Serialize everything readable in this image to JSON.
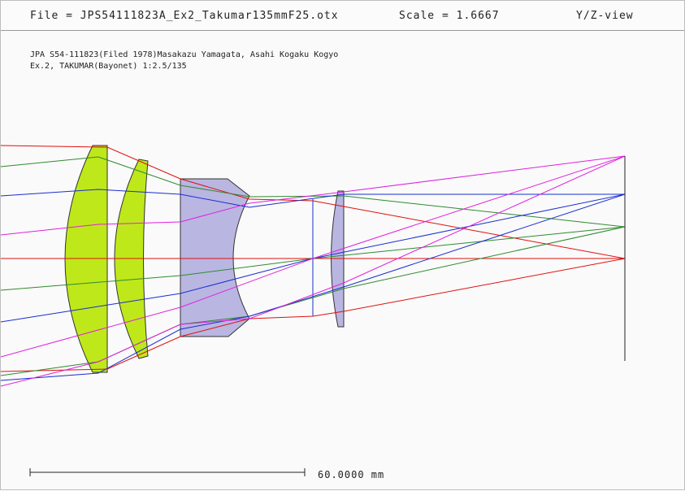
{
  "header": {
    "file": "File = JPS54111823A_Ex2_Takumar135mmF25.otx",
    "scale": "Scale = 1.6667",
    "view": "Y/Z-view"
  },
  "description": {
    "line1": "JPA S54-111823(Filed 1978)Masakazu Yamagata, Asahi Kogaku Kogyo",
    "line2": "Ex.2, TAKUMAR(Bayonet) 1:2.5/135"
  },
  "scale_bar": {
    "label": "60.0000 mm"
  },
  "colors": {
    "positive_element": "#bfe81a",
    "negative_element": "#b9b6e2",
    "ray_axial": "#e01010",
    "ray_field_1": "#2f8a2f",
    "ray_field_2": "#1a2ed0",
    "ray_field_3": "#e020e0",
    "stop_and_image": "#1a2ed0"
  }
}
